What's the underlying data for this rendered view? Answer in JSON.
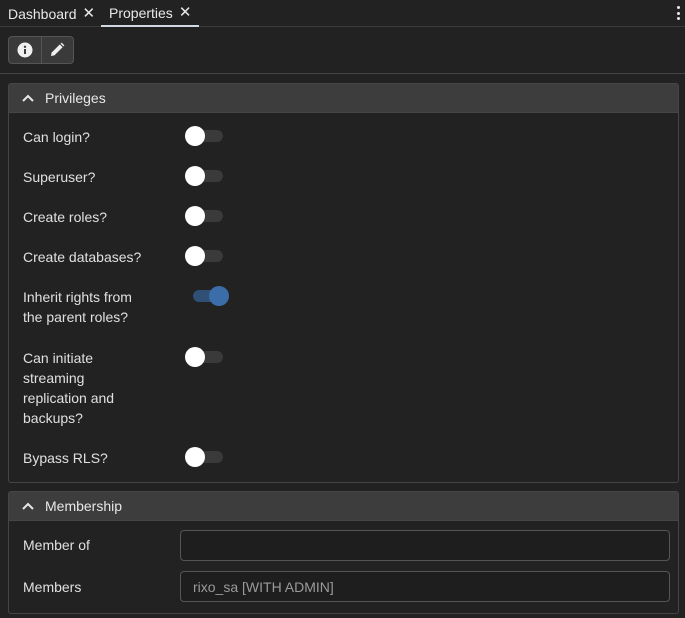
{
  "tabs": [
    {
      "label": "Dashboard",
      "close": "✕"
    },
    {
      "label": "Properties",
      "close": "✕"
    }
  ],
  "toolbar": {
    "info_icon": "info-icon",
    "edit_icon": "pencil-icon"
  },
  "privileges": {
    "title": "Privileges",
    "rows": [
      {
        "label": "Can login?",
        "value": false
      },
      {
        "label": "Superuser?",
        "value": false
      },
      {
        "label": "Create roles?",
        "value": false
      },
      {
        "label": "Create databases?",
        "value": false
      },
      {
        "label_line1": "Inherit rights from",
        "label_line2": "the parent roles?",
        "value": true
      },
      {
        "label_line1": "Can initiate",
        "label_line2": "streaming",
        "label_line3": "replication and",
        "label_line4": "backups?",
        "value": false
      },
      {
        "label": "Bypass RLS?",
        "value": false
      }
    ]
  },
  "membership": {
    "title": "Membership",
    "member_of_label": "Member of",
    "member_of_value": "",
    "members_label": "Members",
    "members_value": "rixo_sa [WITH ADMIN]"
  },
  "colors": {
    "background": "#222222",
    "header": "#3d3d3d",
    "toggle_on": "#3b6ea8"
  }
}
